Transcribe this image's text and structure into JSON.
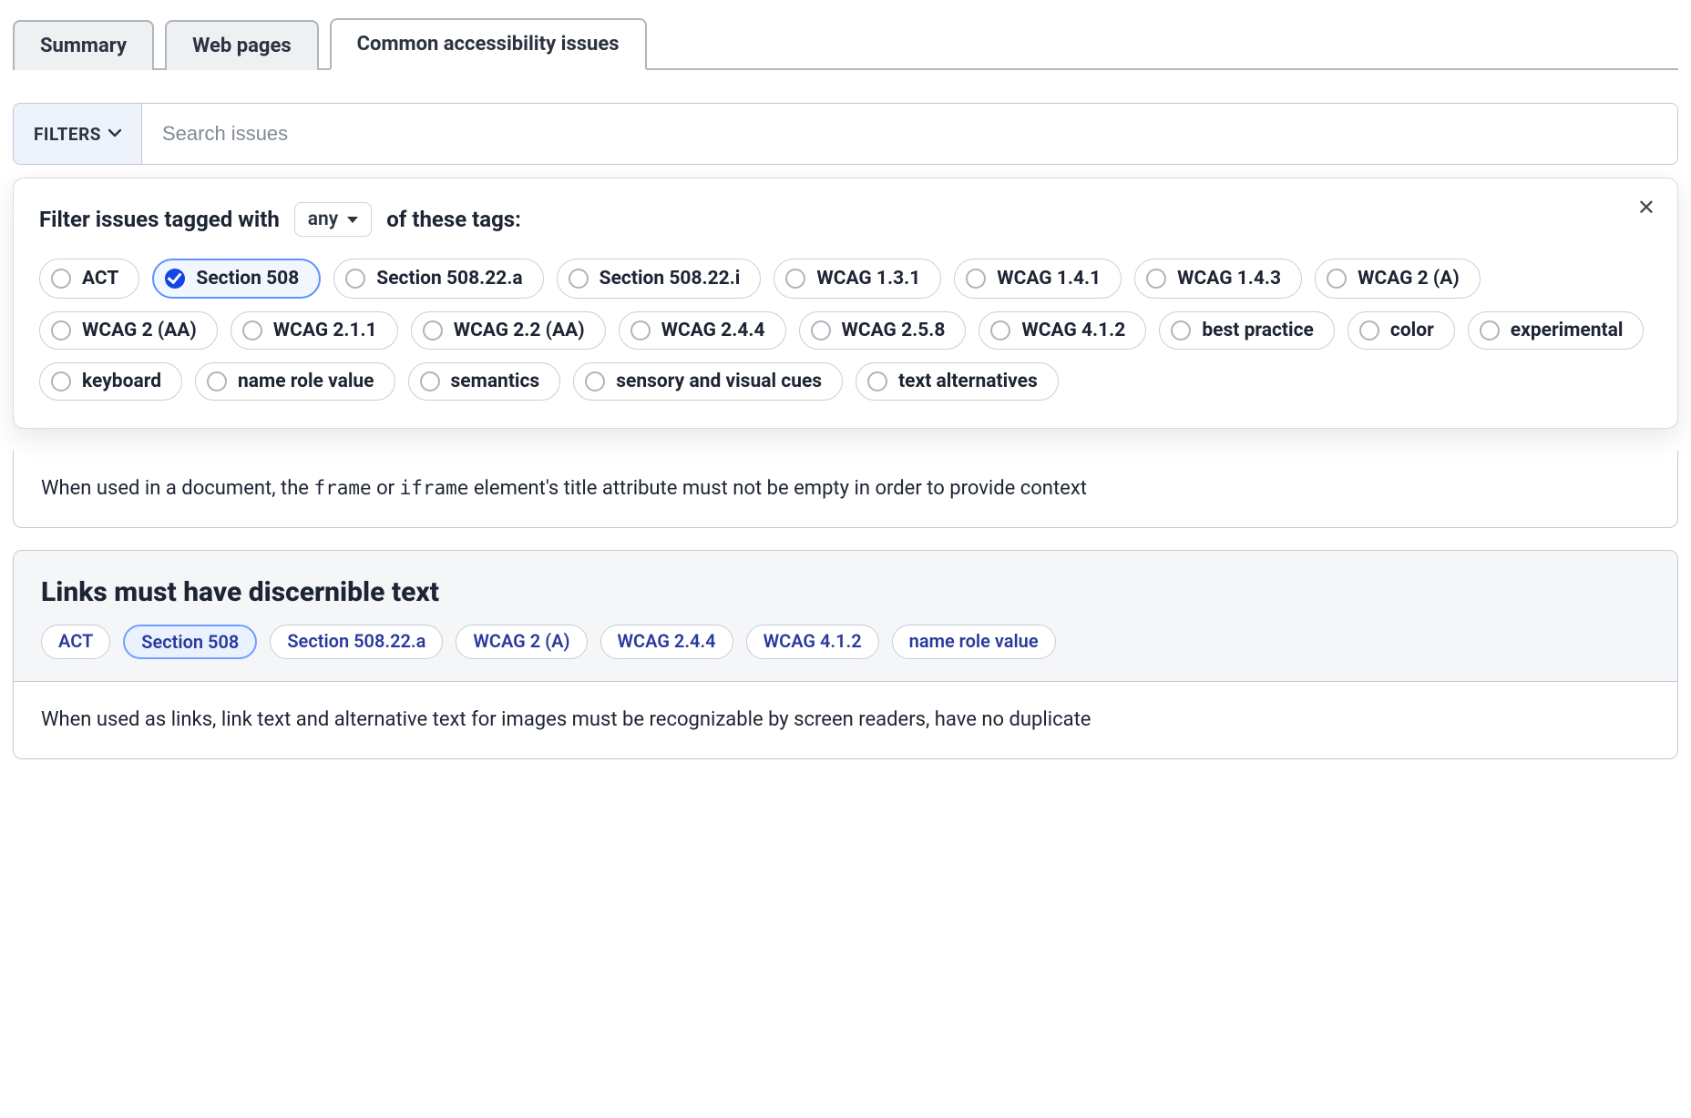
{
  "tabs": [
    {
      "label": "Summary",
      "active": false
    },
    {
      "label": "Web pages",
      "active": false
    },
    {
      "label": "Common accessibility issues",
      "active": true
    }
  ],
  "filterbar": {
    "button_label": "FILTERS",
    "search_placeholder": "Search issues"
  },
  "filter_panel": {
    "prefix": "Filter issues tagged with",
    "mode": "any",
    "suffix": "of these tags:",
    "tags": [
      {
        "label": "ACT",
        "selected": false
      },
      {
        "label": "Section 508",
        "selected": true
      },
      {
        "label": "Section 508.22.a",
        "selected": false
      },
      {
        "label": "Section 508.22.i",
        "selected": false
      },
      {
        "label": "WCAG 1.3.1",
        "selected": false
      },
      {
        "label": "WCAG 1.4.1",
        "selected": false
      },
      {
        "label": "WCAG 1.4.3",
        "selected": false
      },
      {
        "label": "WCAG 2 (A)",
        "selected": false
      },
      {
        "label": "WCAG 2 (AA)",
        "selected": false
      },
      {
        "label": "WCAG 2.1.1",
        "selected": false
      },
      {
        "label": "WCAG 2.2 (AA)",
        "selected": false
      },
      {
        "label": "WCAG 2.4.4",
        "selected": false
      },
      {
        "label": "WCAG 2.5.8",
        "selected": false
      },
      {
        "label": "WCAG 4.1.2",
        "selected": false
      },
      {
        "label": "best practice",
        "selected": false
      },
      {
        "label": "color",
        "selected": false
      },
      {
        "label": "experimental",
        "selected": false
      },
      {
        "label": "keyboard",
        "selected": false
      },
      {
        "label": "name role value",
        "selected": false
      },
      {
        "label": "semantics",
        "selected": false
      },
      {
        "label": "sensory and visual cues",
        "selected": false
      },
      {
        "label": "text alternatives",
        "selected": false
      }
    ]
  },
  "issues": [
    {
      "title_visible": false,
      "title": "",
      "tags": [],
      "body_segments": [
        {
          "text": "When used in a document, the ",
          "code": false
        },
        {
          "text": "frame",
          "code": true
        },
        {
          "text": " or ",
          "code": false
        },
        {
          "text": "iframe",
          "code": true
        },
        {
          "text": " element's title attribute must not be empty in order to provide context",
          "code": false
        }
      ]
    },
    {
      "title_visible": true,
      "title": "Links must have discernible text",
      "tags": [
        {
          "label": "ACT",
          "active": false
        },
        {
          "label": "Section 508",
          "active": true
        },
        {
          "label": "Section 508.22.a",
          "active": false
        },
        {
          "label": "WCAG 2 (A)",
          "active": false
        },
        {
          "label": "WCAG 2.4.4",
          "active": false
        },
        {
          "label": "WCAG 4.1.2",
          "active": false
        },
        {
          "label": "name role value",
          "active": false
        }
      ],
      "body_segments": [
        {
          "text": "When used as links, link text and alternative text for images must be recognizable by screen readers, have no duplicate",
          "code": false
        }
      ]
    }
  ]
}
